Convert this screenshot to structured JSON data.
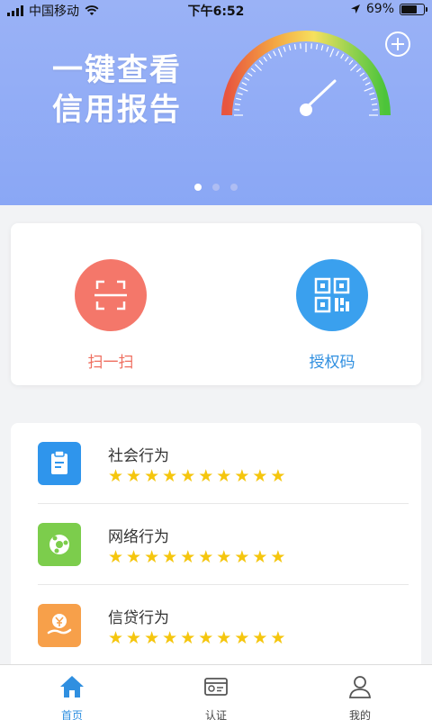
{
  "status_bar": {
    "carrier": "中国移动",
    "time": "下午6:52",
    "battery": "69%",
    "battery_level": 0.69,
    "icons": [
      "signal-icon",
      "wifi-icon",
      "location-icon",
      "battery-icon"
    ]
  },
  "banner": {
    "headline_line1": "一键查看",
    "headline_line2": "信用报告",
    "gauge_colors": [
      "#e8553f",
      "#f4a642",
      "#f6e05e",
      "#8fd14f",
      "#4cc43a"
    ],
    "carousel_page": 1,
    "carousel_total": 3
  },
  "actions": {
    "scan_label": "扫一扫",
    "auth_label": "授权码"
  },
  "behaviors": [
    {
      "title": "社会行为",
      "stars": 10,
      "icon": "clipboard-icon",
      "color": "#2f95ec"
    },
    {
      "title": "网络行为",
      "stars": 10,
      "icon": "network-icon",
      "color": "#7ccd4c"
    },
    {
      "title": "信贷行为",
      "stars": 10,
      "icon": "yuan-hand-icon",
      "color": "#f7a04a"
    }
  ],
  "tabs": [
    {
      "label": "首页",
      "icon": "home-icon",
      "active": true
    },
    {
      "label": "认证",
      "icon": "id-card-icon",
      "active": false
    },
    {
      "label": "我的",
      "icon": "user-icon",
      "active": false
    }
  ],
  "colors": {
    "banner": "#8aa7f5",
    "accent": "#2f8fe0",
    "scan": "#f4776a",
    "star": "#f5c60e"
  }
}
